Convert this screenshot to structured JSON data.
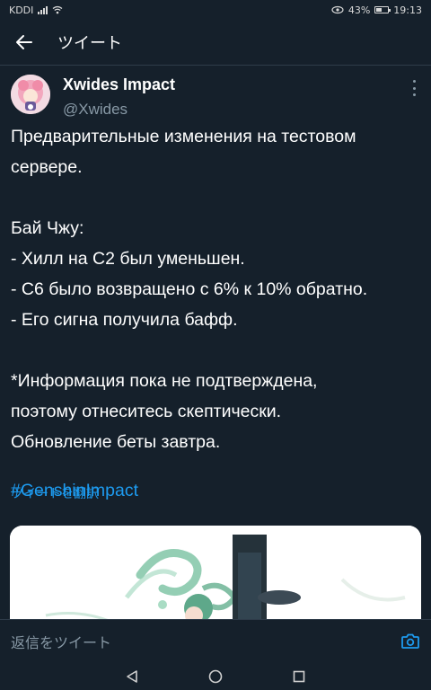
{
  "status_bar": {
    "carrier": "KDDI",
    "battery": "43%",
    "time": "19:13"
  },
  "header": {
    "back_icon": "arrow-left-icon",
    "title": "ツイート"
  },
  "tweet": {
    "author_name": "Xwides Impact",
    "author_handle": "@Xwides",
    "lines": {
      "l1": "Предварительные изменения на тестовом",
      "l2": "сервере.",
      "l3": "Бай Чжу:",
      "l4": "- Хилл на С2 был уменьшен.",
      "l5": "- С6 было возвращено с 6% к 10% обратно.",
      "l6": "- Его сигна получила бафф.",
      "l7": "*Информация пока не подтверждена,",
      "l8": "поэтому отнеситесь скептически.",
      "l9": "Обновление беты завтра."
    },
    "hashtag": "#GenshinImpact",
    "translate_label": "ツイートを翻訳"
  },
  "reply": {
    "placeholder": "返信をツイート",
    "camera_icon": "camera-icon"
  },
  "nav": {
    "back_icon": "triangle-back-icon",
    "home_icon": "circle-home-icon",
    "recents_icon": "square-recents-icon"
  },
  "colors": {
    "background": "#15202b",
    "accent": "#1d9bf0",
    "muted": "#8899a6"
  }
}
